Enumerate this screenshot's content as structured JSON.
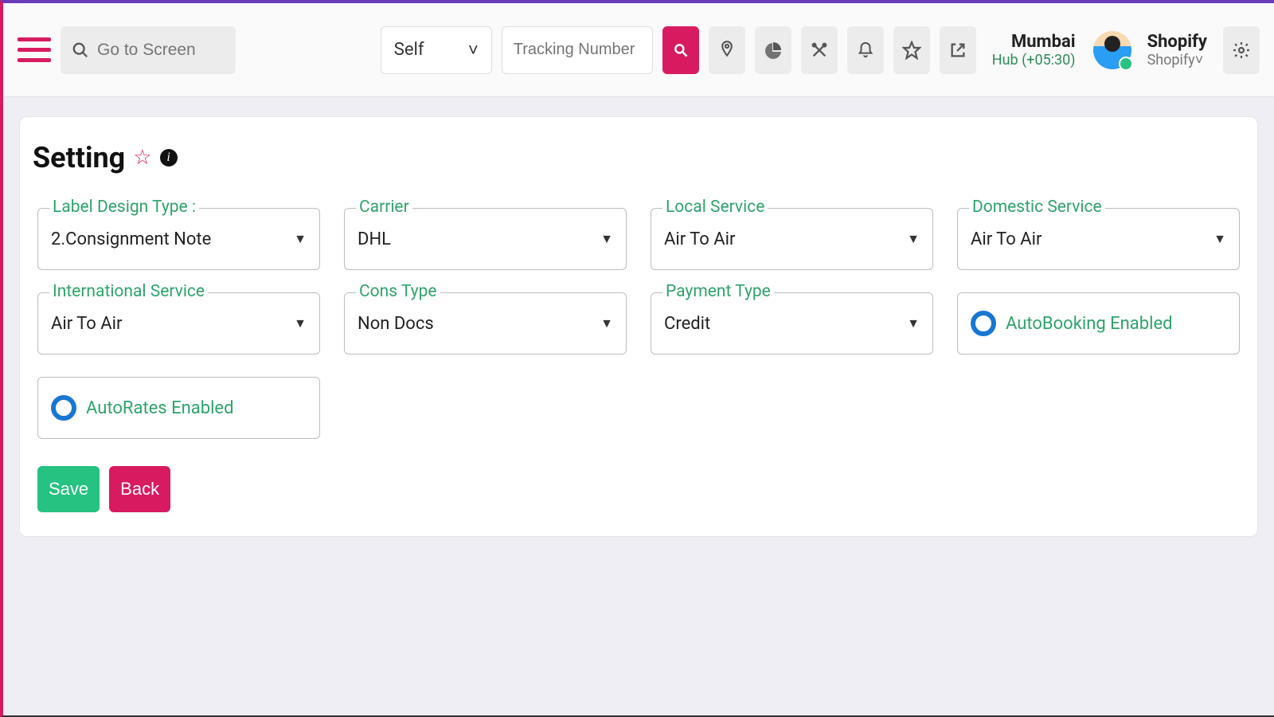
{
  "header": {
    "search_placeholder": "Go to Screen",
    "scope_value": "Self",
    "tracking_placeholder": "Tracking Number",
    "hub_city": "Mumbai",
    "hub_tz": "Hub (+05:30)",
    "user_name": "Shopify",
    "user_role": "Shopify˅"
  },
  "page": {
    "title": "Setting"
  },
  "fields": {
    "label_design_type": {
      "label": "Label Design Type :",
      "value": "2.Consignment Note"
    },
    "carrier": {
      "label": "Carrier",
      "value": "DHL"
    },
    "local_service": {
      "label": "Local Service",
      "value": "Air To Air"
    },
    "domestic_service": {
      "label": "Domestic Service",
      "value": "Air To Air"
    },
    "international_service": {
      "label": "International Service",
      "value": "Air To Air"
    },
    "cons_type": {
      "label": "Cons Type",
      "value": "Non Docs"
    },
    "payment_type": {
      "label": "Payment Type",
      "value": "Credit"
    }
  },
  "toggles": {
    "autobooking": "AutoBooking Enabled",
    "autorates": "AutoRates Enabled"
  },
  "buttons": {
    "save": "Save",
    "back": "Back"
  }
}
